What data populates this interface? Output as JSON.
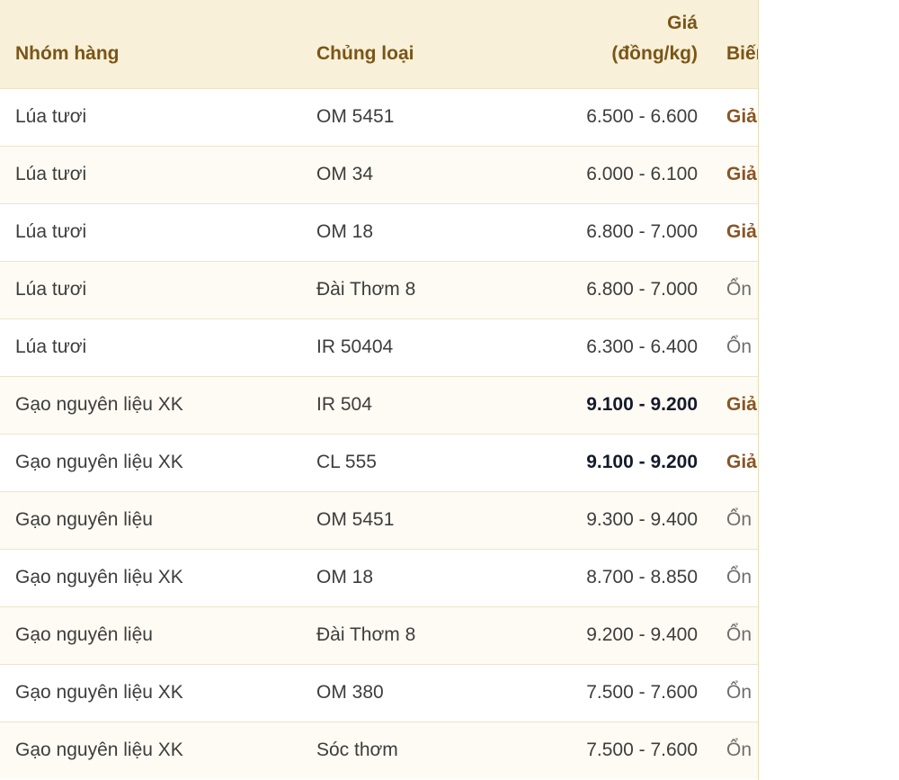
{
  "table": {
    "headers": {
      "group": "Nhóm hàng",
      "type": "Chủng loại",
      "price_line1": "Giá",
      "price_line2": "(đồng/kg)",
      "change": "Biến"
    },
    "rows": [
      {
        "group": "Lúa tươi",
        "type": "OM 5451",
        "price": "6.500 - 6.600",
        "price_bold": false,
        "change": "Giả",
        "change_kind": "down"
      },
      {
        "group": "Lúa tươi",
        "type": "OM 34",
        "price": "6.000 - 6.100",
        "price_bold": false,
        "change": "Giả",
        "change_kind": "down"
      },
      {
        "group": "Lúa tươi",
        "type": "OM 18",
        "price": "6.800 - 7.000",
        "price_bold": false,
        "change": "Giả",
        "change_kind": "down"
      },
      {
        "group": "Lúa tươi",
        "type": "Đài Thơm 8",
        "price": "6.800 - 7.000",
        "price_bold": false,
        "change": "Ổn",
        "change_kind": "stable"
      },
      {
        "group": "Lúa tươi",
        "type": "IR 50404",
        "price": "6.300 - 6.400",
        "price_bold": false,
        "change": "Ổn",
        "change_kind": "stable"
      },
      {
        "group": "Gạo nguyên liệu XK",
        "type": "IR 504",
        "price": "9.100 - 9.200",
        "price_bold": true,
        "change": "Giả",
        "change_kind": "down"
      },
      {
        "group": "Gạo nguyên liệu XK",
        "type": "CL 555",
        "price": "9.100 - 9.200",
        "price_bold": true,
        "change": "Giả",
        "change_kind": "down"
      },
      {
        "group": "Gạo nguyên liệu",
        "type": "OM 5451",
        "price": "9.300 - 9.400",
        "price_bold": false,
        "change": "Ổn",
        "change_kind": "stable"
      },
      {
        "group": "Gạo nguyên liệu XK",
        "type": "OM 18",
        "price": "8.700 - 8.850",
        "price_bold": false,
        "change": "Ổn",
        "change_kind": "stable"
      },
      {
        "group": "Gạo nguyên liệu",
        "type": "Đài Thơm 8",
        "price": "9.200 - 9.400",
        "price_bold": false,
        "change": "Ổn",
        "change_kind": "stable"
      },
      {
        "group": "Gạo nguyên liệu XK",
        "type": "OM 380",
        "price": "7.500 - 7.600",
        "price_bold": false,
        "change": "Ổn",
        "change_kind": "stable"
      },
      {
        "group": "Gạo nguyên liệu XK",
        "type": "Sóc thơm",
        "price": "7.500 - 7.600",
        "price_bold": false,
        "change": "Ổn",
        "change_kind": "stable"
      }
    ]
  },
  "colors": {
    "header_bg": "#f8f0d8",
    "header_text": "#7a5518",
    "change_down": "#8a5523",
    "change_stable": "#6e6e6e"
  }
}
